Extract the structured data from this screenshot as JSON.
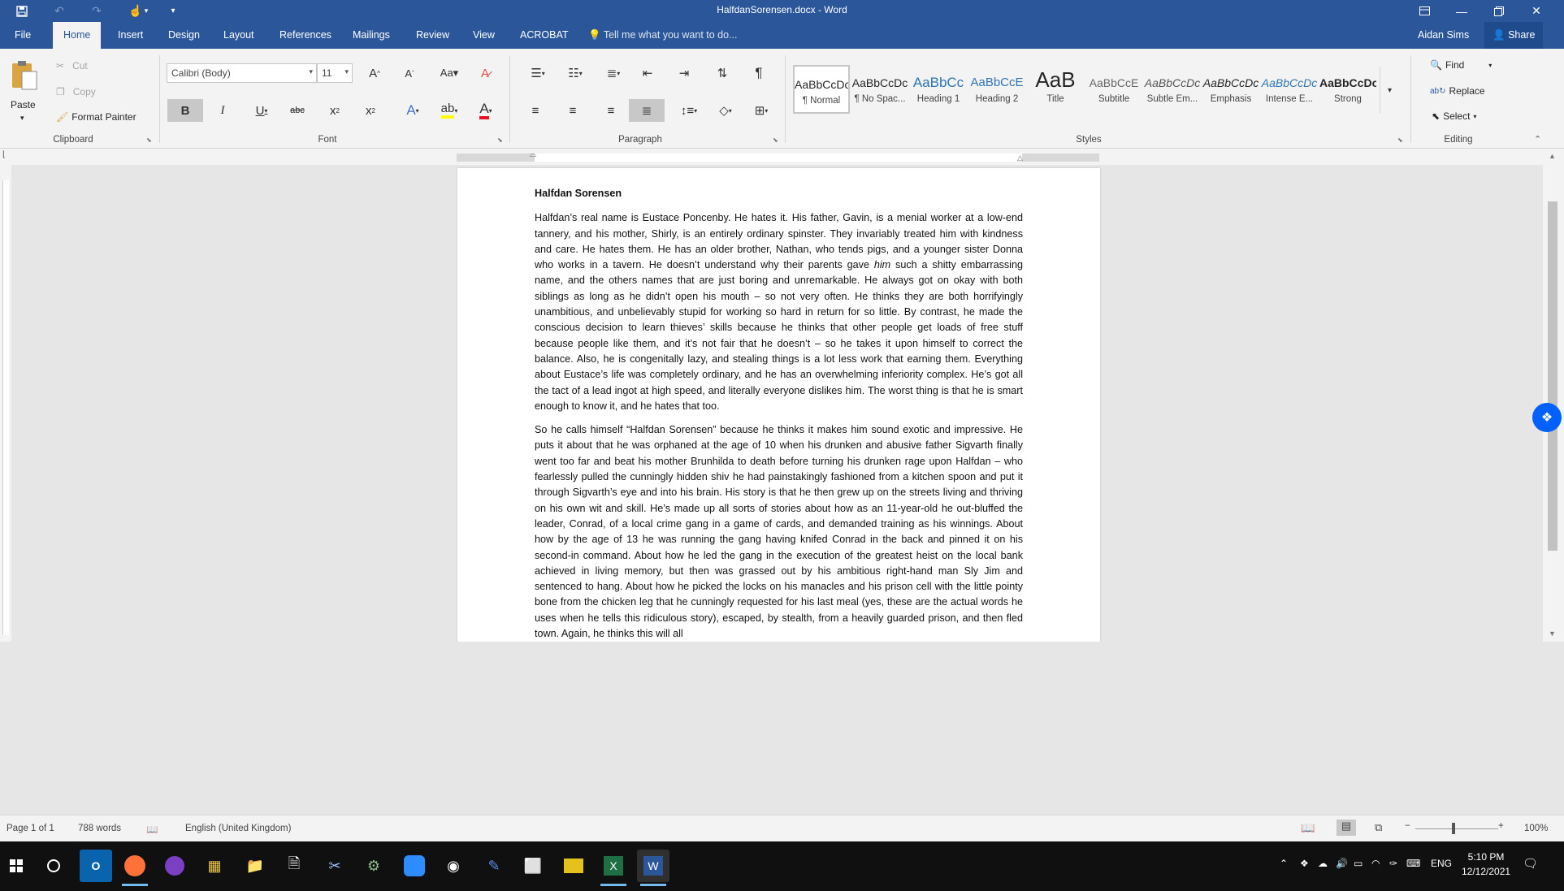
{
  "titlebar": {
    "title": "HalfdanSorensen.docx - Word",
    "customize_label": "▾"
  },
  "tabs": [
    {
      "label": "File"
    },
    {
      "label": "Home"
    },
    {
      "label": "Insert"
    },
    {
      "label": "Design"
    },
    {
      "label": "Layout"
    },
    {
      "label": "References"
    },
    {
      "label": "Mailings"
    },
    {
      "label": "Review"
    },
    {
      "label": "View"
    },
    {
      "label": "ACROBAT"
    }
  ],
  "tellme": "Tell me what you want to do...",
  "user": "Aidan Sims",
  "share": "Share",
  "clipboard": {
    "paste": "Paste",
    "cut": "Cut",
    "copy": "Copy",
    "format_painter": "Format Painter",
    "group": "Clipboard"
  },
  "font": {
    "family": "Calibri (Body)",
    "size": "11",
    "group": "Font"
  },
  "paragraph": {
    "group": "Paragraph"
  },
  "styles": {
    "group": "Styles",
    "items": [
      {
        "sample": "AaBbCcDc",
        "name": "¶ Normal"
      },
      {
        "sample": "AaBbCcDc",
        "name": "¶ No Spac..."
      },
      {
        "sample": "AaBbCc",
        "name": "Heading 1"
      },
      {
        "sample": "AaBbCcE",
        "name": "Heading 2"
      },
      {
        "sample": "AaB",
        "name": "Title"
      },
      {
        "sample": "AaBbCcE",
        "name": "Subtitle"
      },
      {
        "sample": "AaBbCcDc",
        "name": "Subtle Em..."
      },
      {
        "sample": "AaBbCcDc",
        "name": "Emphasis"
      },
      {
        "sample": "AaBbCcDc",
        "name": "Intense E..."
      },
      {
        "sample": "AaBbCcDc",
        "name": "Strong"
      }
    ]
  },
  "editing": {
    "group": "Editing",
    "find": "Find",
    "replace": "Replace",
    "select": "Select"
  },
  "document": {
    "heading": "Halfdan Sorensen",
    "para1_a": "Halfdan’s real name is Eustace Poncenby. He hates it. His father, Gavin, is a menial worker at a low-end tannery, and his mother, Shirly, is an entirely ordinary spinster. They invariably treated him with kindness and care. He hates them. He has an older brother, Nathan, who tends pigs, and a younger sister Donna who works in a tavern. He doesn’t understand why their parents gave ",
    "para1_em": "him",
    "para1_b": " such a shitty embarrassing name, and the others names that are just boring and unremarkable. He always got on okay with both siblings as long as he didn’t open his mouth – so not very often. He thinks they are both horrifyingly unambitious, and unbelievably stupid for working so hard in return for so little. By contrast, he made the conscious decision to learn thieves’ skills because he thinks that other people get loads of free stuff because people like them, and it’s not fair that he doesn’t – so he takes it upon himself to correct the balance. Also, he is congenitally lazy, and stealing things is a lot less work that earning them. Everything about Eustace’s life was completely ordinary, and he has an overwhelming inferiority complex. He’s got all the tact of a lead ingot at high speed, and literally everyone dislikes him. The worst thing is that he is smart enough to know it, and he hates that too.",
    "para2": "So he calls himself “Halfdan Sorensen” because he thinks it makes him sound exotic and impressive. He puts it about that he was orphaned at the age of 10 when his drunken and abusive father Sigvarth finally went too far and beat his mother Brunhilda to death before turning his drunken rage upon Halfdan – who fearlessly pulled the cunningly hidden shiv he had painstakingly fashioned from a kitchen spoon and put it through Sigvarth’s eye and into his brain. His story is that he then grew up on the streets living and thriving on his own wit and skill. He’s made up all sorts of stories about how as an 11-year-old he out-bluffed the leader, Conrad, of a local crime gang in a game of cards, and demanded training as his winnings. About how by the age of 13 he was running the gang having knifed Conrad in the back and pinned it on his second-in command. About how he led the gang in the execution of the greatest heist on the local bank achieved in living memory, but then was grassed out by his ambitious right-hand man Sly Jim and sentenced to hang. About how he picked the locks on his manacles and his prison cell with the little pointy bone from the chicken leg that he cunningly requested for his last meal (yes, these are the actual words he uses when he tells this ridiculous story), escaped, by stealth, from a heavily guarded prison, and then fled town. Again, he thinks this will all"
  },
  "status": {
    "page": "Page 1 of 1",
    "words": "788 words",
    "language": "English (United Kingdom)",
    "zoom": "100%"
  },
  "taskbar": {
    "lang": "ENG",
    "time": "5:10 PM",
    "date": "12/12/2021"
  }
}
